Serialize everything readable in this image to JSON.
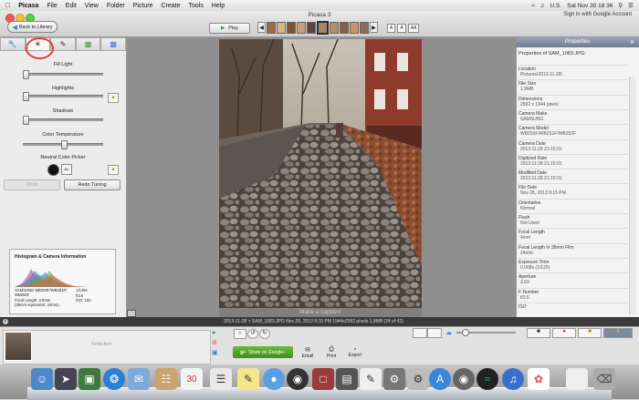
{
  "menubar": {
    "apple": "",
    "items": [
      "Picasa",
      "File",
      "Edit",
      "View",
      "Folder",
      "Picture",
      "Create",
      "Tools",
      "Help"
    ],
    "status_flag": "U.S.",
    "clock": "Sat Nov 30  18 36"
  },
  "window": {
    "title": "Picasa 3",
    "back_label": "Back to Library",
    "play_label": "Play",
    "signin": "Sign in with Google Account",
    "size_toggles": [
      "A",
      "A",
      "AA"
    ]
  },
  "tools": {
    "tabs": [
      "wrench",
      "sun",
      "brush",
      "paint",
      "effects"
    ],
    "sliders": [
      {
        "label": "Fill Light",
        "level": 0.0
      },
      {
        "label": "Highlights",
        "level": 0.0
      },
      {
        "label": "Shadows",
        "level": 0.0
      },
      {
        "label": "Color Temperature",
        "level": 0.5
      }
    ],
    "color_picker_label": "Neutral Color Picker",
    "undo_label": "Undo",
    "redo_label": "Redo Tuning"
  },
  "histogram": {
    "title": "Histogram & Camera Information",
    "camera": "SAMSUNG WB250F/WB251F/ WB252F",
    "shutter": "1/125s",
    "aperture": "f/3.6",
    "focal": "Focal Length: 4.0mm",
    "iso": "ISO: 100",
    "equiv": "(35mm equivalent: 24mm)"
  },
  "caption": "Make a caption!",
  "properties": {
    "header": "Properties",
    "subtitle": "Properties of SAM_1083.JPG:",
    "rows": [
      {
        "k": "Location",
        "v": "Pictures\\2013-11-28\\"
      },
      {
        "k": "File Size",
        "v": "1.9MB"
      },
      {
        "k": "Dimensions",
        "v": "2592 x 1944 pixels"
      },
      {
        "k": "Camera Make",
        "v": "SAMSUNG"
      },
      {
        "k": "Camera Model",
        "v": "WB250F/WB251F/WB252F"
      },
      {
        "k": "Camera Date",
        "v": "2013:11:28 21:15:01"
      },
      {
        "k": "Digitized Date",
        "v": "2013:11:28 21:15:01"
      },
      {
        "k": "Modified Date",
        "v": "2013:11:28 21:15:01"
      },
      {
        "k": "File Date",
        "v": "Nov 28, 2013 9:15 PM"
      },
      {
        "k": "Orientation",
        "v": "Normal"
      },
      {
        "k": "Flash",
        "v": "Not Used"
      },
      {
        "k": "Focal Length",
        "v": "4mm"
      },
      {
        "k": "Focal Length In 35mm Film",
        "v": "24mm"
      },
      {
        "k": "Exposure Time",
        "v": "0.008s (1/125)"
      },
      {
        "k": "Aperture",
        "v": "3.69"
      },
      {
        "k": "F Number",
        "v": "f/3.6"
      },
      {
        "k": "ISO",
        "v": ""
      }
    ]
  },
  "status": {
    "text": "2013-11-28 > SAM_1083.JPG   Nov 28, 2013 9:15 PM   1944x2592 pixels   1.9MB   (24 of 42)"
  },
  "tray": {
    "selection_label": "Selection",
    "share_label": "Share on Google+",
    "actions": [
      "Email",
      "Print",
      "Export"
    ]
  },
  "colors": {
    "accent": "#e0412f",
    "share_green": "#4fa52a",
    "props_header": "#7d8a9c"
  }
}
